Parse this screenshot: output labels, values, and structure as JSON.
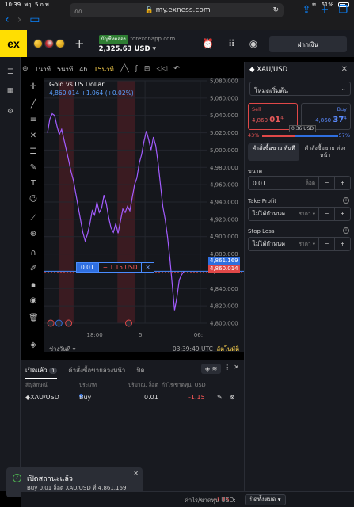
{
  "status_bar": {
    "time": "10:39",
    "date": "พฤ. 5 ก.พ.",
    "battery": "61%"
  },
  "browser": {
    "tab_text": "กก",
    "url": "my.exness.com"
  },
  "header": {
    "logo": "ex",
    "account_tag": "บัญชีทดลอง",
    "server": "forexonapp.com",
    "balance": "2,325.63 USD",
    "deposit_label": "ฝากเงิน"
  },
  "chart_toolbar": {
    "timeframes": [
      "1นาที",
      "5นาที",
      "4h",
      "15นาที"
    ],
    "active_timeframe": "15นาที"
  },
  "chart": {
    "symbol_name": "Gold vs US Dollar",
    "quote_line": "4,860.014 +1.064 (+0.02%)",
    "position_lot": "0.01",
    "position_pnl": "− 1.15 USD",
    "position_close": "✕",
    "bid_price": "4,860.014",
    "ask_price": "4,861.169",
    "range_label": "ช่วงวันที่",
    "clock": "03:39:49 UTC",
    "auto_label": "อัตโนมัติ"
  },
  "chart_data": {
    "type": "line",
    "title": "Gold vs US Dollar",
    "x_tick_labels": [
      "18:00",
      "5",
      "06:"
    ],
    "y_tick_labels": [
      "5,080.000",
      "5,060.000",
      "5,040.000",
      "5,020.000",
      "5,000.000",
      "4,980.000",
      "4,960.000",
      "4,940.000",
      "4,920.000",
      "4,900.000",
      "4,880.000",
      "4,860.000",
      "4,840.000",
      "4,820.000",
      "4,800.000"
    ],
    "ylim": [
      4800,
      5080
    ],
    "series": [
      {
        "values": [
          5020,
          5036,
          5042,
          5040,
          5028,
          5018,
          5024,
          5012,
          5000,
          4988,
          4975,
          4965,
          4950,
          4935,
          4920,
          4905,
          4895,
          4903,
          4915,
          4930,
          4925,
          4940,
          4928,
          4933,
          4948,
          4938,
          4922,
          4910,
          4905,
          4915,
          4904,
          4918,
          4932,
          4928,
          4935,
          4930,
          4945,
          4960,
          4968,
          4985,
          4995,
          5010,
          5022,
          5012,
          5000,
          5015,
          5005,
          4985,
          4960,
          4935,
          4920,
          4900,
          4875,
          4845,
          4815,
          4830,
          4850,
          4856,
          4860
        ]
      }
    ],
    "shaded_regions": [
      [
        0.09,
        0.18
      ],
      [
        0.45,
        0.56
      ]
    ],
    "bid_line": 4860.014,
    "grid": true
  },
  "trade_panel": {
    "symbol": "XAU/USD",
    "mode": "โหมดเริ่มต้น",
    "sell_label": "Sell",
    "sell_price_main": "4,860 ",
    "sell_price_big": "01",
    "sell_price_sup": "4",
    "buy_label": "Buy",
    "buy_price_main": "4,860 ",
    "buy_price_big": "37",
    "buy_price_sup": "4",
    "spread": "0.36 USD",
    "sell_ratio": "43%",
    "buy_ratio": "57%",
    "sell_ratio_value": 0.43,
    "tab_market": "คำสั่งซื้อขาย ทันที",
    "tab_pending": "คำสั่งซื้อขาย ล่วงหน้า",
    "volume_label": "ขนาด",
    "volume_value": "0.01",
    "volume_unit": "ล็อต",
    "tp_label": "Take Profit",
    "tp_value": "ไม่ได้กำหนด",
    "tp_unit": "ราคา",
    "sl_label": "Stop Loss",
    "sl_value": "ไม่ได้กำหนด",
    "sl_unit": "ราคา"
  },
  "positions": {
    "tab_open": "เปิดแล้ว",
    "tab_open_count": "1",
    "tab_pending": "คำสั่งซื้อขายล่วงหน้า",
    "tab_closed": "ปิด",
    "col_symbol": "สัญลักษณ์",
    "col_type": "ประเภท",
    "col_volume": "ปริมาณ, ล็อต",
    "col_pnl": "กำไร/ขาดทุน, USD",
    "row": {
      "symbol": "XAU/USD",
      "type": "Buy",
      "volume": "0.01",
      "pnl": "-1.15"
    }
  },
  "toast": {
    "title": "เปิดสถานะแล้ว",
    "message": "Buy 0.01 ล็อต XAU/USD ที่ 4,861.169"
  },
  "footer": {
    "pnl_label": "ค่าไร/ขาดทุน USD:",
    "pnl_value": "-1.15",
    "close_all": "ปิดทั้งหมด"
  },
  "colors": {
    "line": "#a35cff",
    "sell": "#e04848",
    "buy": "#2f6fe0",
    "accent": "#ffde02",
    "background": "#15171c"
  }
}
